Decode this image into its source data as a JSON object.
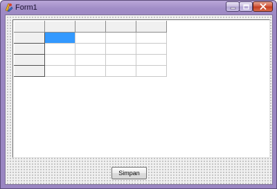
{
  "window": {
    "title": "Form1",
    "controls": {
      "minimize": "minimize-icon",
      "maximize": "maximize-icon",
      "close": "close-icon"
    }
  },
  "grid": {
    "fixed_rows": 1,
    "fixed_cols": 1,
    "rows": 5,
    "cols": 5,
    "selected_cell": {
      "row": 1,
      "col": 1
    },
    "cells": [
      [
        "",
        "",
        "",
        "",
        ""
      ],
      [
        "",
        "",
        "",
        "",
        ""
      ],
      [
        "",
        "",
        "",
        "",
        ""
      ],
      [
        "",
        "",
        "",
        "",
        ""
      ],
      [
        "",
        "",
        "",
        "",
        ""
      ]
    ]
  },
  "form": {
    "save_button_label": "Simpan"
  },
  "colors": {
    "title_bar": "#a08cc6",
    "selection": "#3399ff",
    "close_button": "#c23a1e"
  }
}
